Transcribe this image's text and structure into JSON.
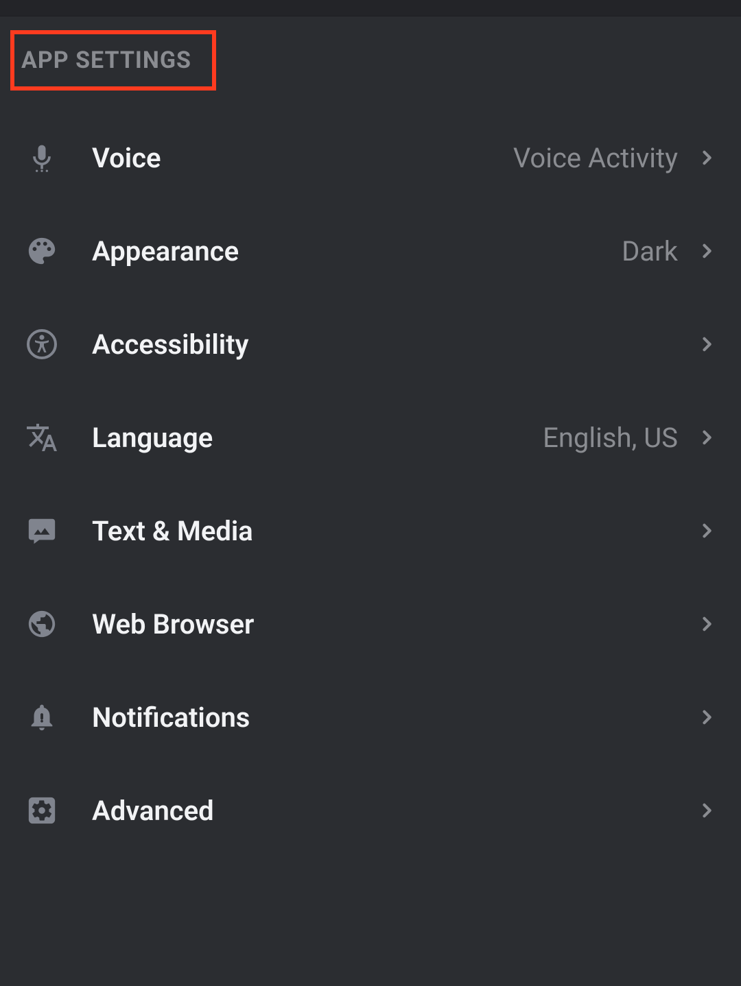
{
  "section_header": "APP SETTINGS",
  "items": [
    {
      "label": "Voice",
      "value": "Voice Activity"
    },
    {
      "label": "Appearance",
      "value": "Dark"
    },
    {
      "label": "Accessibility",
      "value": ""
    },
    {
      "label": "Language",
      "value": "English, US"
    },
    {
      "label": "Text & Media",
      "value": ""
    },
    {
      "label": "Web Browser",
      "value": ""
    },
    {
      "label": "Notifications",
      "value": ""
    },
    {
      "label": "Advanced",
      "value": ""
    }
  ],
  "highlight_color": "#ff3b1f"
}
